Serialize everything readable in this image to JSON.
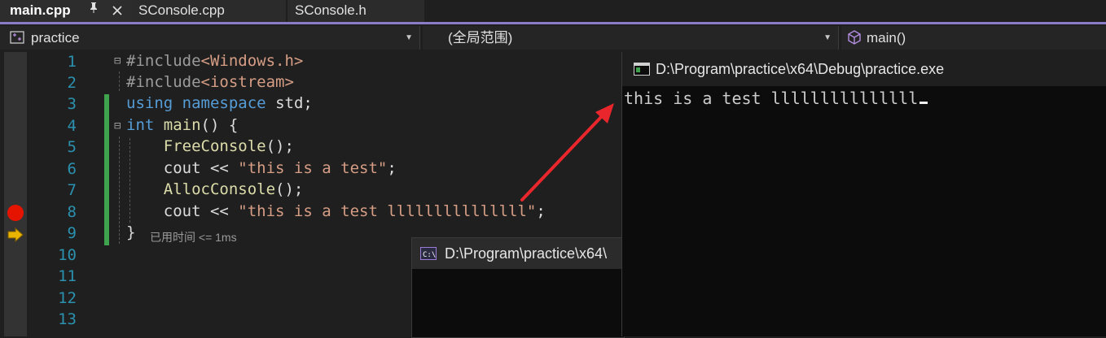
{
  "tabs": [
    {
      "label": "main.cpp",
      "active": true
    },
    {
      "label": "SConsole.cpp",
      "active": false
    },
    {
      "label": "SConsole.h",
      "active": false
    }
  ],
  "tab_icons": {
    "pin": "pin-icon",
    "close": "close-icon"
  },
  "navbar": {
    "project": "practice",
    "scope": "(全局范围)",
    "member": "main()"
  },
  "editor": {
    "line_numbers": [
      "1",
      "2",
      "3",
      "4",
      "5",
      "6",
      "7",
      "8",
      "9",
      "10",
      "11",
      "12",
      "13"
    ],
    "lines": [
      {
        "pre": "#include",
        "inc": "<Windows.h>"
      },
      {
        "pre": "#include",
        "inc": "<iostream>"
      },
      {
        "kw1": "using",
        "kw2": "namespace",
        "rest": "std;"
      },
      {
        "kw": "int",
        "fn": "main",
        "rest": "() {"
      },
      {
        "fn": "FreeConsole",
        "rest": "();"
      },
      {
        "id": "cout",
        "op": " << ",
        "str": "\"this is a test\"",
        "end": ";"
      },
      {
        "fn": "AllocConsole",
        "rest": "();"
      },
      {
        "id": "cout",
        "op": " << ",
        "str": "\"this is a test lllllllllllllll\"",
        "end": ";"
      },
      {
        "rest": "}"
      }
    ],
    "perf_tip": "已用时间 <= 1ms",
    "breakpoint_color": "#e51400",
    "change_bar_color": "#3fa34d"
  },
  "console_back": {
    "title": "D:\\Program\\practice\\x64\\"
  },
  "console_front": {
    "title": "D:\\Program\\practice\\x64\\Debug\\practice.exe",
    "output": "this is a test lllllllllllllll"
  },
  "colors": {
    "accent": "#8b7cc8",
    "annotation_arrow": "#e8262b"
  }
}
